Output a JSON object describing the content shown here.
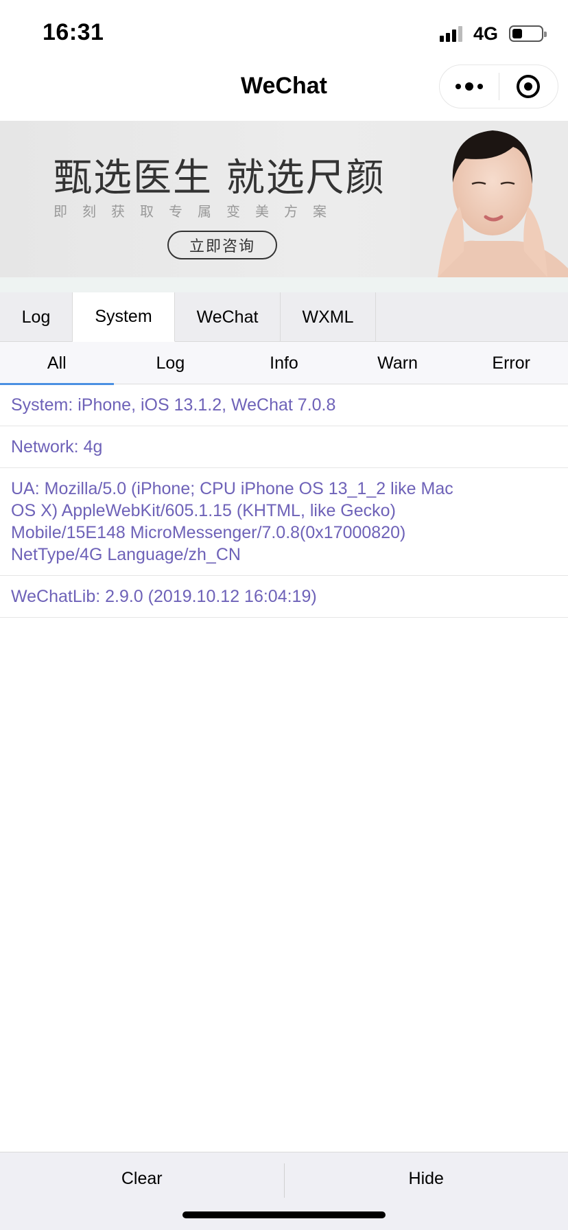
{
  "status_bar": {
    "time": "16:31",
    "network": "4G",
    "signal_bars": 3,
    "battery_level_pct": 35
  },
  "nav": {
    "title": "WeChat",
    "more_icon": "more-dots-icon",
    "close_icon": "target-close-icon"
  },
  "banner": {
    "title": "甄选医生 就选尺颜",
    "subtitle": "即刻获取专属变美方案",
    "button_label": "立即咨询"
  },
  "panel_tabs": [
    {
      "label": "Log",
      "active": false
    },
    {
      "label": "System",
      "active": true
    },
    {
      "label": "WeChat",
      "active": false
    },
    {
      "label": "WXML",
      "active": false
    }
  ],
  "sub_tabs": [
    {
      "label": "All",
      "active": true
    },
    {
      "label": "Log",
      "active": false
    },
    {
      "label": "Info",
      "active": false
    },
    {
      "label": "Warn",
      "active": false
    },
    {
      "label": "Error",
      "active": false
    }
  ],
  "log_rows": [
    "System: iPhone, iOS 13.1.2, WeChat 7.0.8",
    "Network: 4g",
    "UA: Mozilla/5.0 (iPhone; CPU iPhone OS 13_1_2 like Mac\nOS X) AppleWebKit/605.1.15 (KHTML, like Gecko)\nMobile/15E148 MicroMessenger/7.0.8(0x17000820)\nNetType/4G Language/zh_CN",
    "WeChatLib: 2.9.0 (2019.10.12 16:04:19)"
  ],
  "toolbar": {
    "clear_label": "Clear",
    "hide_label": "Hide"
  },
  "colors": {
    "log_text": "#6e62b8",
    "active_underline": "#4a90e2",
    "panel_bg": "#ededf0"
  }
}
